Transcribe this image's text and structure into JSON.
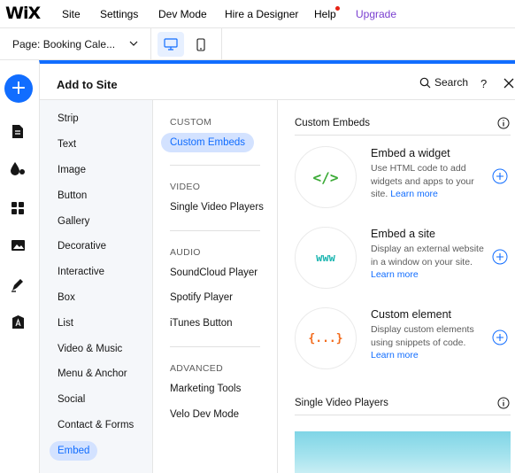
{
  "topbar": {
    "logo": "WiX",
    "nav": [
      {
        "label": "Site"
      },
      {
        "label": "Settings"
      },
      {
        "label": "Dev Mode"
      },
      {
        "label": "Hire a Designer"
      },
      {
        "label": "Help"
      },
      {
        "label": "Upgrade"
      }
    ]
  },
  "pagebar": {
    "page_label": "Page: Booking Cale...",
    "device_modes": [
      "desktop-icon",
      "mobile-icon"
    ]
  },
  "rail": {
    "icons": [
      "plus-icon",
      "page-icon",
      "design-icon",
      "apps-icon",
      "media-icon",
      "pen-icon",
      "business-icon"
    ]
  },
  "panel": {
    "title": "Add to Site",
    "search_label": "Search",
    "help_label": "?",
    "categories": [
      {
        "label": "Strip"
      },
      {
        "label": "Text"
      },
      {
        "label": "Image"
      },
      {
        "label": "Button"
      },
      {
        "label": "Gallery"
      },
      {
        "label": "Decorative"
      },
      {
        "label": "Interactive"
      },
      {
        "label": "Box"
      },
      {
        "label": "List"
      },
      {
        "label": "Video & Music"
      },
      {
        "label": "Menu & Anchor"
      },
      {
        "label": "Social"
      },
      {
        "label": "Contact & Forms"
      },
      {
        "label": "Embed",
        "active": true
      }
    ],
    "sections": {
      "custom": {
        "heading": "CUSTOM",
        "items": [
          "Custom Embeds"
        ]
      },
      "video": {
        "heading": "VIDEO",
        "items": [
          "Single Video Players"
        ]
      },
      "audio": {
        "heading": "AUDIO",
        "items": [
          "SoundCloud Player",
          "Spotify Player",
          "iTunes Button"
        ]
      },
      "advanced": {
        "heading": "ADVANCED",
        "items": [
          "Marketing Tools",
          "Velo Dev Mode"
        ]
      }
    },
    "content": {
      "custom_embeds_title": "Custom Embeds",
      "cards": [
        {
          "title": "Embed a widget",
          "description": "Use HTML code to add widgets and apps to your site.",
          "link": "Learn more",
          "icon_text": "</>",
          "icon_color": "#3aaa35"
        },
        {
          "title": "Embed a site",
          "description": "Display an external website in a window on your site.",
          "link": "Learn more",
          "icon_text": "www",
          "icon_color": "#1ab5b0"
        },
        {
          "title": "Custom element",
          "description": "Display custom elements using snippets of code.",
          "link": "Learn more",
          "icon_text": "{...}",
          "icon_color": "#f26a1b"
        }
      ],
      "single_video_title": "Single Video Players"
    }
  },
  "colors": {
    "accent": "#116dff",
    "active_bg": "#d3e2ff",
    "upgrade": "#7a3fd0"
  }
}
